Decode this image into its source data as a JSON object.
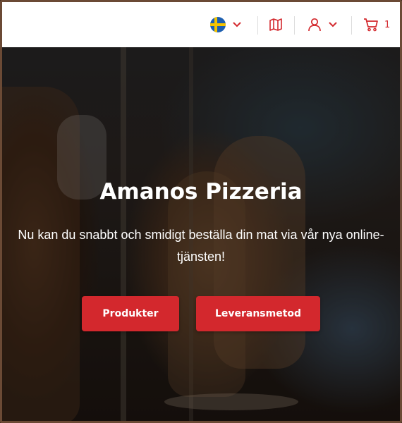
{
  "header": {
    "language": {
      "flag": "sweden-flag-icon",
      "chevron": "chevron-down-icon"
    },
    "map_icon": "map-icon",
    "account": {
      "icon": "user-icon",
      "chevron": "chevron-down-icon"
    },
    "cart": {
      "icon": "cart-icon",
      "count": "1"
    }
  },
  "hero": {
    "title": "Amanos Pizzeria",
    "subtitle": "Nu kan du snabbt och smidigt beställa din mat via vår nya online-tjänsten!",
    "buttons": {
      "products_label": "Produkter",
      "delivery_label": "Leveransmetod"
    }
  },
  "colors": {
    "accent": "#d3282d",
    "header_bg": "#ffffff",
    "text_light": "#ffffff"
  }
}
